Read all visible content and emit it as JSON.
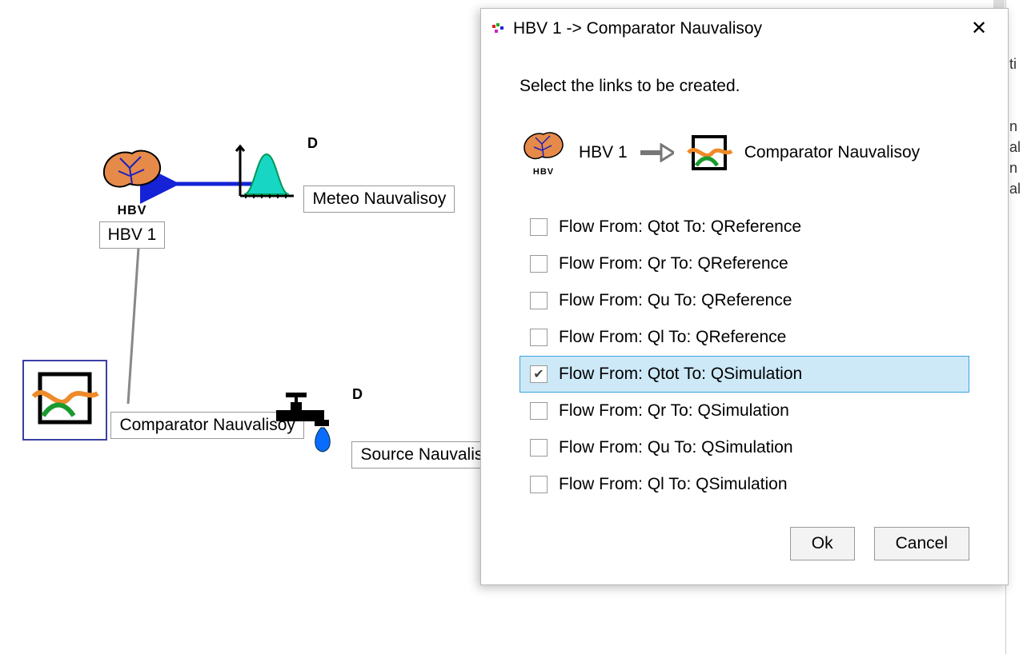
{
  "canvas": {
    "nodes": {
      "hbv": {
        "label": "HBV 1",
        "icon_caption": "HBV"
      },
      "meteo": {
        "label": "Meteo Nauvalisoy",
        "corner_label": "D"
      },
      "comparator": {
        "label": "Comparator Nauvalisoy"
      },
      "source": {
        "label": "Source Nauvalisoy",
        "corner_label": "D"
      }
    }
  },
  "dialog": {
    "title": "HBV 1 -> Comparator Nauvalisoy",
    "prompt": "Select the links to be created.",
    "source_name": "HBV 1",
    "target_name": "Comparator Nauvalisoy",
    "options": [
      {
        "label": "Flow  From: Qtot  To: QReference",
        "checked": false,
        "selected": false
      },
      {
        "label": "Flow  From: Qr  To: QReference",
        "checked": false,
        "selected": false
      },
      {
        "label": "Flow  From: Qu  To: QReference",
        "checked": false,
        "selected": false
      },
      {
        "label": "Flow  From: Ql  To: QReference",
        "checked": false,
        "selected": false
      },
      {
        "label": "Flow  From: Qtot  To: QSimulation",
        "checked": true,
        "selected": true
      },
      {
        "label": "Flow  From: Qr  To: QSimulation",
        "checked": false,
        "selected": false
      },
      {
        "label": "Flow  From: Qu  To: QSimulation",
        "checked": false,
        "selected": false
      },
      {
        "label": "Flow  From: Ql  To: QSimulation",
        "checked": false,
        "selected": false
      }
    ],
    "buttons": {
      "ok": "Ok",
      "cancel": "Cancel"
    }
  },
  "sliver": {
    "fragments": [
      "ti",
      "n",
      "al",
      "n",
      "al"
    ]
  }
}
